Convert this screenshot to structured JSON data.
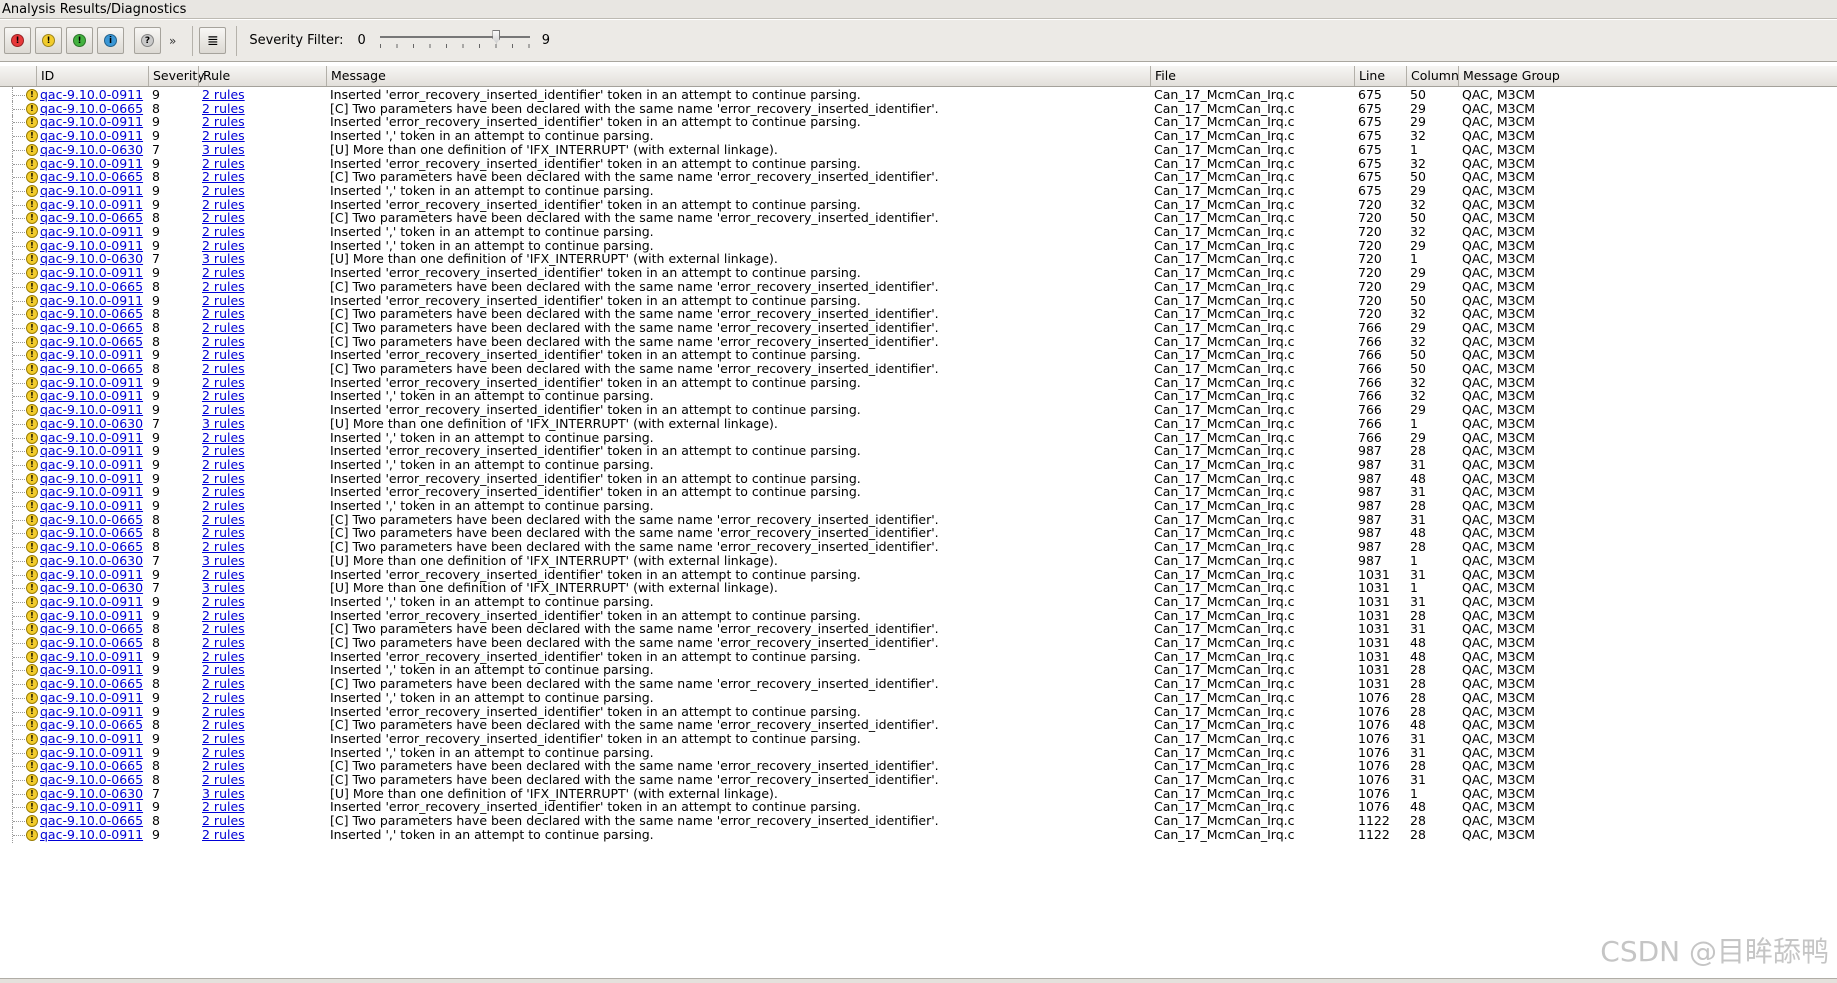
{
  "window": {
    "title": "Analysis Results/Diagnostics"
  },
  "toolbar": {
    "severity_buttons": [
      {
        "glyph": "!",
        "color": "#e8383a"
      },
      {
        "glyph": "!",
        "color": "#f2cc2c"
      },
      {
        "glyph": "!",
        "color": "#43b23f"
      },
      {
        "glyph": "i",
        "color": "#3a97d6"
      },
      {
        "glyph": "?",
        "color": "#c9c9c9"
      }
    ],
    "more": "»",
    "view_menu_glyph": "≣",
    "filter_label": "Severity Filter:",
    "filter_min": "0",
    "filter_max": "9",
    "filter_value": 7
  },
  "columns": [
    "ID",
    "Severity",
    "Rule",
    "Message",
    "File",
    "Line",
    "Column",
    "Message Group"
  ],
  "warning_glyph": "!",
  "rows": [
    [
      "qac-9.10.0-0911",
      "9",
      "2 rules",
      "Inserted 'error_recovery_inserted_identifier' token in an attempt to continue parsing.",
      "Can_17_McmCan_Irq.c",
      "675",
      "50",
      "QAC, M3CM"
    ],
    [
      "qac-9.10.0-0665",
      "8",
      "2 rules",
      "[C] Two parameters have been declared with the same name 'error_recovery_inserted_identifier'.",
      "Can_17_McmCan_Irq.c",
      "675",
      "29",
      "QAC, M3CM"
    ],
    [
      "qac-9.10.0-0911",
      "9",
      "2 rules",
      "Inserted 'error_recovery_inserted_identifier' token in an attempt to continue parsing.",
      "Can_17_McmCan_Irq.c",
      "675",
      "29",
      "QAC, M3CM"
    ],
    [
      "qac-9.10.0-0911",
      "9",
      "2 rules",
      "Inserted ',' token in an attempt to continue parsing.",
      "Can_17_McmCan_Irq.c",
      "675",
      "32",
      "QAC, M3CM"
    ],
    [
      "qac-9.10.0-0630",
      "7",
      "3 rules",
      "[U] More than one definition of 'IFX_INTERRUPT' (with external linkage).",
      "Can_17_McmCan_Irq.c",
      "675",
      "1",
      "QAC, M3CM"
    ],
    [
      "qac-9.10.0-0911",
      "9",
      "2 rules",
      "Inserted 'error_recovery_inserted_identifier' token in an attempt to continue parsing.",
      "Can_17_McmCan_Irq.c",
      "675",
      "32",
      "QAC, M3CM"
    ],
    [
      "qac-9.10.0-0665",
      "8",
      "2 rules",
      "[C] Two parameters have been declared with the same name 'error_recovery_inserted_identifier'.",
      "Can_17_McmCan_Irq.c",
      "675",
      "50",
      "QAC, M3CM"
    ],
    [
      "qac-9.10.0-0911",
      "9",
      "2 rules",
      "Inserted ',' token in an attempt to continue parsing.",
      "Can_17_McmCan_Irq.c",
      "675",
      "29",
      "QAC, M3CM"
    ],
    [
      "qac-9.10.0-0911",
      "9",
      "2 rules",
      "Inserted 'error_recovery_inserted_identifier' token in an attempt to continue parsing.",
      "Can_17_McmCan_Irq.c",
      "720",
      "32",
      "QAC, M3CM"
    ],
    [
      "qac-9.10.0-0665",
      "8",
      "2 rules",
      "[C] Two parameters have been declared with the same name 'error_recovery_inserted_identifier'.",
      "Can_17_McmCan_Irq.c",
      "720",
      "50",
      "QAC, M3CM"
    ],
    [
      "qac-9.10.0-0911",
      "9",
      "2 rules",
      "Inserted ',' token in an attempt to continue parsing.",
      "Can_17_McmCan_Irq.c",
      "720",
      "32",
      "QAC, M3CM"
    ],
    [
      "qac-9.10.0-0911",
      "9",
      "2 rules",
      "Inserted ',' token in an attempt to continue parsing.",
      "Can_17_McmCan_Irq.c",
      "720",
      "29",
      "QAC, M3CM"
    ],
    [
      "qac-9.10.0-0630",
      "7",
      "3 rules",
      "[U] More than one definition of 'IFX_INTERRUPT' (with external linkage).",
      "Can_17_McmCan_Irq.c",
      "720",
      "1",
      "QAC, M3CM"
    ],
    [
      "qac-9.10.0-0911",
      "9",
      "2 rules",
      "Inserted 'error_recovery_inserted_identifier' token in an attempt to continue parsing.",
      "Can_17_McmCan_Irq.c",
      "720",
      "29",
      "QAC, M3CM"
    ],
    [
      "qac-9.10.0-0665",
      "8",
      "2 rules",
      "[C] Two parameters have been declared with the same name 'error_recovery_inserted_identifier'.",
      "Can_17_McmCan_Irq.c",
      "720",
      "29",
      "QAC, M3CM"
    ],
    [
      "qac-9.10.0-0911",
      "9",
      "2 rules",
      "Inserted 'error_recovery_inserted_identifier' token in an attempt to continue parsing.",
      "Can_17_McmCan_Irq.c",
      "720",
      "50",
      "QAC, M3CM"
    ],
    [
      "qac-9.10.0-0665",
      "8",
      "2 rules",
      "[C] Two parameters have been declared with the same name 'error_recovery_inserted_identifier'.",
      "Can_17_McmCan_Irq.c",
      "720",
      "32",
      "QAC, M3CM"
    ],
    [
      "qac-9.10.0-0665",
      "8",
      "2 rules",
      "[C] Two parameters have been declared with the same name 'error_recovery_inserted_identifier'.",
      "Can_17_McmCan_Irq.c",
      "766",
      "29",
      "QAC, M3CM"
    ],
    [
      "qac-9.10.0-0665",
      "8",
      "2 rules",
      "[C] Two parameters have been declared with the same name 'error_recovery_inserted_identifier'.",
      "Can_17_McmCan_Irq.c",
      "766",
      "32",
      "QAC, M3CM"
    ],
    [
      "qac-9.10.0-0911",
      "9",
      "2 rules",
      "Inserted 'error_recovery_inserted_identifier' token in an attempt to continue parsing.",
      "Can_17_McmCan_Irq.c",
      "766",
      "50",
      "QAC, M3CM"
    ],
    [
      "qac-9.10.0-0665",
      "8",
      "2 rules",
      "[C] Two parameters have been declared with the same name 'error_recovery_inserted_identifier'.",
      "Can_17_McmCan_Irq.c",
      "766",
      "50",
      "QAC, M3CM"
    ],
    [
      "qac-9.10.0-0911",
      "9",
      "2 rules",
      "Inserted 'error_recovery_inserted_identifier' token in an attempt to continue parsing.",
      "Can_17_McmCan_Irq.c",
      "766",
      "32",
      "QAC, M3CM"
    ],
    [
      "qac-9.10.0-0911",
      "9",
      "2 rules",
      "Inserted ',' token in an attempt to continue parsing.",
      "Can_17_McmCan_Irq.c",
      "766",
      "32",
      "QAC, M3CM"
    ],
    [
      "qac-9.10.0-0911",
      "9",
      "2 rules",
      "Inserted 'error_recovery_inserted_identifier' token in an attempt to continue parsing.",
      "Can_17_McmCan_Irq.c",
      "766",
      "29",
      "QAC, M3CM"
    ],
    [
      "qac-9.10.0-0630",
      "7",
      "3 rules",
      "[U] More than one definition of 'IFX_INTERRUPT' (with external linkage).",
      "Can_17_McmCan_Irq.c",
      "766",
      "1",
      "QAC, M3CM"
    ],
    [
      "qac-9.10.0-0911",
      "9",
      "2 rules",
      "Inserted ',' token in an attempt to continue parsing.",
      "Can_17_McmCan_Irq.c",
      "766",
      "29",
      "QAC, M3CM"
    ],
    [
      "qac-9.10.0-0911",
      "9",
      "2 rules",
      "Inserted 'error_recovery_inserted_identifier' token in an attempt to continue parsing.",
      "Can_17_McmCan_Irq.c",
      "987",
      "28",
      "QAC, M3CM"
    ],
    [
      "qac-9.10.0-0911",
      "9",
      "2 rules",
      "Inserted ',' token in an attempt to continue parsing.",
      "Can_17_McmCan_Irq.c",
      "987",
      "31",
      "QAC, M3CM"
    ],
    [
      "qac-9.10.0-0911",
      "9",
      "2 rules",
      "Inserted 'error_recovery_inserted_identifier' token in an attempt to continue parsing.",
      "Can_17_McmCan_Irq.c",
      "987",
      "48",
      "QAC, M3CM"
    ],
    [
      "qac-9.10.0-0911",
      "9",
      "2 rules",
      "Inserted 'error_recovery_inserted_identifier' token in an attempt to continue parsing.",
      "Can_17_McmCan_Irq.c",
      "987",
      "31",
      "QAC, M3CM"
    ],
    [
      "qac-9.10.0-0911",
      "9",
      "2 rules",
      "Inserted ',' token in an attempt to continue parsing.",
      "Can_17_McmCan_Irq.c",
      "987",
      "28",
      "QAC, M3CM"
    ],
    [
      "qac-9.10.0-0665",
      "8",
      "2 rules",
      "[C] Two parameters have been declared with the same name 'error_recovery_inserted_identifier'.",
      "Can_17_McmCan_Irq.c",
      "987",
      "31",
      "QAC, M3CM"
    ],
    [
      "qac-9.10.0-0665",
      "8",
      "2 rules",
      "[C] Two parameters have been declared with the same name 'error_recovery_inserted_identifier'.",
      "Can_17_McmCan_Irq.c",
      "987",
      "48",
      "QAC, M3CM"
    ],
    [
      "qac-9.10.0-0665",
      "8",
      "2 rules",
      "[C] Two parameters have been declared with the same name 'error_recovery_inserted_identifier'.",
      "Can_17_McmCan_Irq.c",
      "987",
      "28",
      "QAC, M3CM"
    ],
    [
      "qac-9.10.0-0630",
      "7",
      "3 rules",
      "[U] More than one definition of 'IFX_INTERRUPT' (with external linkage).",
      "Can_17_McmCan_Irq.c",
      "987",
      "1",
      "QAC, M3CM"
    ],
    [
      "qac-9.10.0-0911",
      "9",
      "2 rules",
      "Inserted 'error_recovery_inserted_identifier' token in an attempt to continue parsing.",
      "Can_17_McmCan_Irq.c",
      "1031",
      "31",
      "QAC, M3CM"
    ],
    [
      "qac-9.10.0-0630",
      "7",
      "3 rules",
      "[U] More than one definition of 'IFX_INTERRUPT' (with external linkage).",
      "Can_17_McmCan_Irq.c",
      "1031",
      "1",
      "QAC, M3CM"
    ],
    [
      "qac-9.10.0-0911",
      "9",
      "2 rules",
      "Inserted ',' token in an attempt to continue parsing.",
      "Can_17_McmCan_Irq.c",
      "1031",
      "31",
      "QAC, M3CM"
    ],
    [
      "qac-9.10.0-0911",
      "9",
      "2 rules",
      "Inserted 'error_recovery_inserted_identifier' token in an attempt to continue parsing.",
      "Can_17_McmCan_Irq.c",
      "1031",
      "28",
      "QAC, M3CM"
    ],
    [
      "qac-9.10.0-0665",
      "8",
      "2 rules",
      "[C] Two parameters have been declared with the same name 'error_recovery_inserted_identifier'.",
      "Can_17_McmCan_Irq.c",
      "1031",
      "31",
      "QAC, M3CM"
    ],
    [
      "qac-9.10.0-0665",
      "8",
      "2 rules",
      "[C] Two parameters have been declared with the same name 'error_recovery_inserted_identifier'.",
      "Can_17_McmCan_Irq.c",
      "1031",
      "48",
      "QAC, M3CM"
    ],
    [
      "qac-9.10.0-0911",
      "9",
      "2 rules",
      "Inserted 'error_recovery_inserted_identifier' token in an attempt to continue parsing.",
      "Can_17_McmCan_Irq.c",
      "1031",
      "48",
      "QAC, M3CM"
    ],
    [
      "qac-9.10.0-0911",
      "9",
      "2 rules",
      "Inserted ',' token in an attempt to continue parsing.",
      "Can_17_McmCan_Irq.c",
      "1031",
      "28",
      "QAC, M3CM"
    ],
    [
      "qac-9.10.0-0665",
      "8",
      "2 rules",
      "[C] Two parameters have been declared with the same name 'error_recovery_inserted_identifier'.",
      "Can_17_McmCan_Irq.c",
      "1031",
      "28",
      "QAC, M3CM"
    ],
    [
      "qac-9.10.0-0911",
      "9",
      "2 rules",
      "Inserted ',' token in an attempt to continue parsing.",
      "Can_17_McmCan_Irq.c",
      "1076",
      "28",
      "QAC, M3CM"
    ],
    [
      "qac-9.10.0-0911",
      "9",
      "2 rules",
      "Inserted 'error_recovery_inserted_identifier' token in an attempt to continue parsing.",
      "Can_17_McmCan_Irq.c",
      "1076",
      "28",
      "QAC, M3CM"
    ],
    [
      "qac-9.10.0-0665",
      "8",
      "2 rules",
      "[C] Two parameters have been declared with the same name 'error_recovery_inserted_identifier'.",
      "Can_17_McmCan_Irq.c",
      "1076",
      "48",
      "QAC, M3CM"
    ],
    [
      "qac-9.10.0-0911",
      "9",
      "2 rules",
      "Inserted 'error_recovery_inserted_identifier' token in an attempt to continue parsing.",
      "Can_17_McmCan_Irq.c",
      "1076",
      "31",
      "QAC, M3CM"
    ],
    [
      "qac-9.10.0-0911",
      "9",
      "2 rules",
      "Inserted ',' token in an attempt to continue parsing.",
      "Can_17_McmCan_Irq.c",
      "1076",
      "31",
      "QAC, M3CM"
    ],
    [
      "qac-9.10.0-0665",
      "8",
      "2 rules",
      "[C] Two parameters have been declared with the same name 'error_recovery_inserted_identifier'.",
      "Can_17_McmCan_Irq.c",
      "1076",
      "28",
      "QAC, M3CM"
    ],
    [
      "qac-9.10.0-0665",
      "8",
      "2 rules",
      "[C] Two parameters have been declared with the same name 'error_recovery_inserted_identifier'.",
      "Can_17_McmCan_Irq.c",
      "1076",
      "31",
      "QAC, M3CM"
    ],
    [
      "qac-9.10.0-0630",
      "7",
      "3 rules",
      "[U] More than one definition of 'IFX_INTERRUPT' (with external linkage).",
      "Can_17_McmCan_Irq.c",
      "1076",
      "1",
      "QAC, M3CM"
    ],
    [
      "qac-9.10.0-0911",
      "9",
      "2 rules",
      "Inserted 'error_recovery_inserted_identifier' token in an attempt to continue parsing.",
      "Can_17_McmCan_Irq.c",
      "1076",
      "48",
      "QAC, M3CM"
    ],
    [
      "qac-9.10.0-0665",
      "8",
      "2 rules",
      "[C] Two parameters have been declared with the same name 'error_recovery_inserted_identifier'.",
      "Can_17_McmCan_Irq.c",
      "1122",
      "28",
      "QAC, M3CM"
    ],
    [
      "qac-9.10.0-0911",
      "9",
      "2 rules",
      "Inserted ',' token in an attempt to continue parsing.",
      "Can_17_McmCan_Irq.c",
      "1122",
      "28",
      "QAC, M3CM"
    ]
  ],
  "watermark": "CSDN @目眸舔鸭"
}
